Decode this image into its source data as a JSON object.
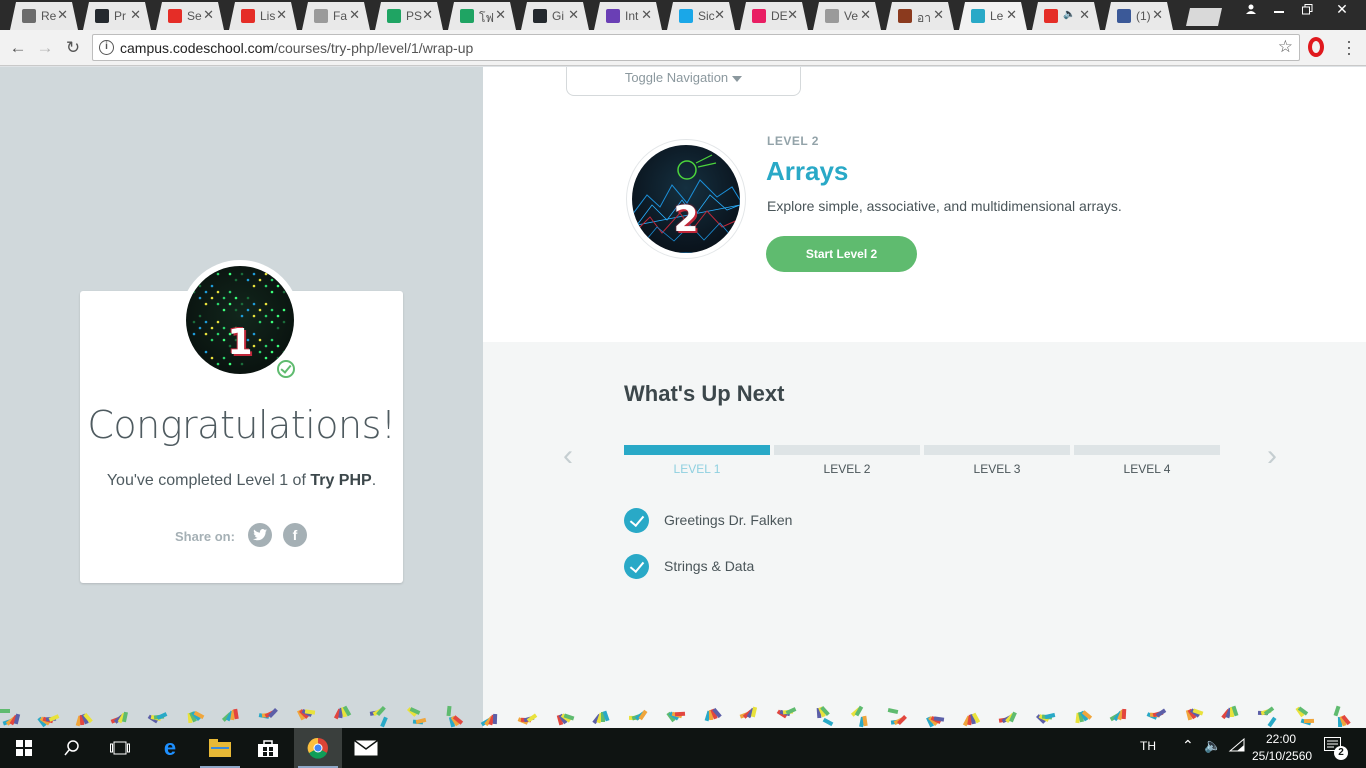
{
  "browser": {
    "tabs": [
      {
        "title": "Re",
        "favicon": "window-icon",
        "color": "#6b6b6b"
      },
      {
        "title": "Pr",
        "favicon": "github-icon",
        "color": "#24292e"
      },
      {
        "title": "Se",
        "favicon": "youtube-icon",
        "color": "#e52d27"
      },
      {
        "title": "Lis",
        "favicon": "youtube-icon",
        "color": "#e52d27"
      },
      {
        "title": "Fa",
        "favicon": "doc-t-icon",
        "color": "#9a9a9a"
      },
      {
        "title": "PS",
        "favicon": "drive-icon",
        "color": "#1fa463"
      },
      {
        "title": "โฟ",
        "favicon": "drive-icon",
        "color": "#1fa463"
      },
      {
        "title": "Gi",
        "favicon": "github-icon",
        "color": "#24292e"
      },
      {
        "title": "Int",
        "favicon": "list-icon",
        "color": "#6a3fb5"
      },
      {
        "title": "Sic",
        "favicon": "u-icon",
        "color": "#1aa7e8"
      },
      {
        "title": "DE",
        "favicon": "music-icon",
        "color": "#e91e63"
      },
      {
        "title": "Ve",
        "favicon": "page-icon",
        "color": "#9a9a9a"
      },
      {
        "title": "อา",
        "favicon": "paw-icon",
        "color": "#8b3a1e"
      },
      {
        "title": "Le",
        "favicon": "code-icon",
        "color": "#29a9c7",
        "active": true
      },
      {
        "title": "",
        "favicon": "youtube-icon",
        "color": "#e52d27",
        "audio": true
      },
      {
        "title": "(1)",
        "favicon": "facebook-icon",
        "color": "#3b5998"
      }
    ],
    "url_host": "campus.codeschool.com",
    "url_path": "/courses/try-php/level/1/wrap-up"
  },
  "nav": {
    "toggle_label": "Toggle Navigation"
  },
  "next_level": {
    "kicker": "LEVEL 2",
    "title": "Arrays",
    "description": "Explore simple, associative, and multidimensional arrays.",
    "button": "Start Level 2",
    "badge_number": "2"
  },
  "congrats": {
    "badge_number": "1",
    "heading": "Congratulations!",
    "completed_prefix": "You've completed Level 1 of ",
    "course_name": "Try PHP",
    "completed_suffix": ".",
    "share_label": "Share on:"
  },
  "up_next": {
    "title": "What's Up Next",
    "levels": [
      "LEVEL 1",
      "LEVEL 2",
      "LEVEL 3",
      "LEVEL 4"
    ],
    "active_level_index": 0,
    "challenges": [
      "Greetings Dr. Falken",
      "Strings & Data"
    ]
  },
  "taskbar": {
    "language": "TH",
    "time": "22:00",
    "date": "25/10/2560",
    "notification_count": "2"
  },
  "colors": {
    "accent": "#29a9c7",
    "success": "#5fbb6f",
    "left_panel": "#d0d8db"
  }
}
